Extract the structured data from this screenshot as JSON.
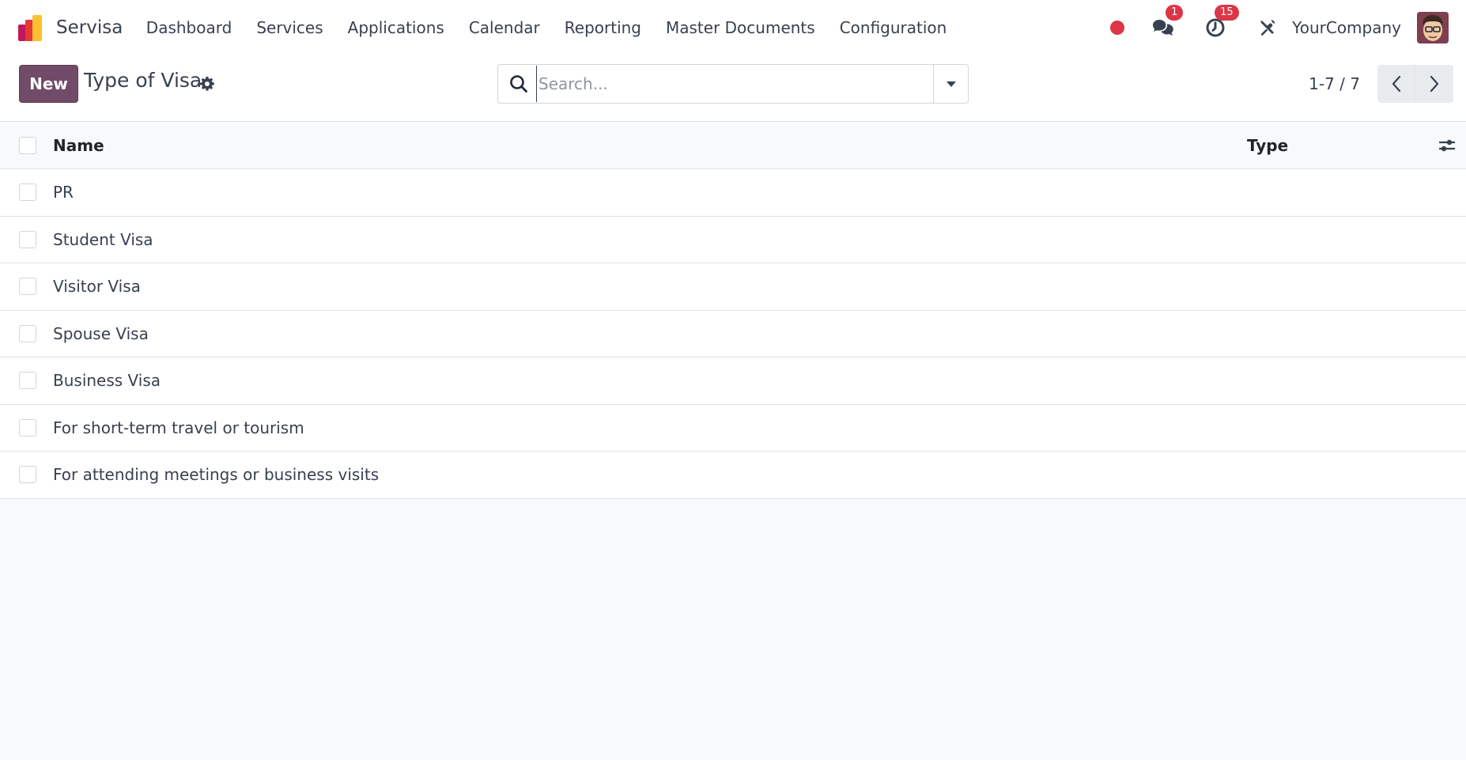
{
  "app": {
    "name": "Servisa"
  },
  "menu": [
    {
      "label": "Dashboard"
    },
    {
      "label": "Services"
    },
    {
      "label": "Applications"
    },
    {
      "label": "Calendar"
    },
    {
      "label": "Reporting"
    },
    {
      "label": "Master Documents"
    },
    {
      "label": "Configuration"
    }
  ],
  "systray": {
    "recording_color": "#dc3545",
    "messages_icon": "chat-icon",
    "messages_count": "1",
    "activities_icon": "clock-icon",
    "activities_count": "15",
    "debug_icon": "tools-icon",
    "company": "YourCompany"
  },
  "control": {
    "new_label": "New",
    "title": "Type of Visa",
    "search_placeholder": "Search...",
    "pager": "1-7 / 7"
  },
  "list": {
    "columns": {
      "name": "Name",
      "type": "Type"
    },
    "rows": [
      {
        "name": "PR",
        "type": ""
      },
      {
        "name": "Student Visa",
        "type": ""
      },
      {
        "name": "Visitor Visa",
        "type": ""
      },
      {
        "name": "Spouse Visa",
        "type": ""
      },
      {
        "name": "Business Visa",
        "type": ""
      },
      {
        "name": "For short-term travel or tourism",
        "type": ""
      },
      {
        "name": "For attending meetings or business visits",
        "type": ""
      }
    ]
  },
  "colors": {
    "brand_primary": "#714b67",
    "badge": "#dc3545",
    "background": "#f9fafb"
  }
}
